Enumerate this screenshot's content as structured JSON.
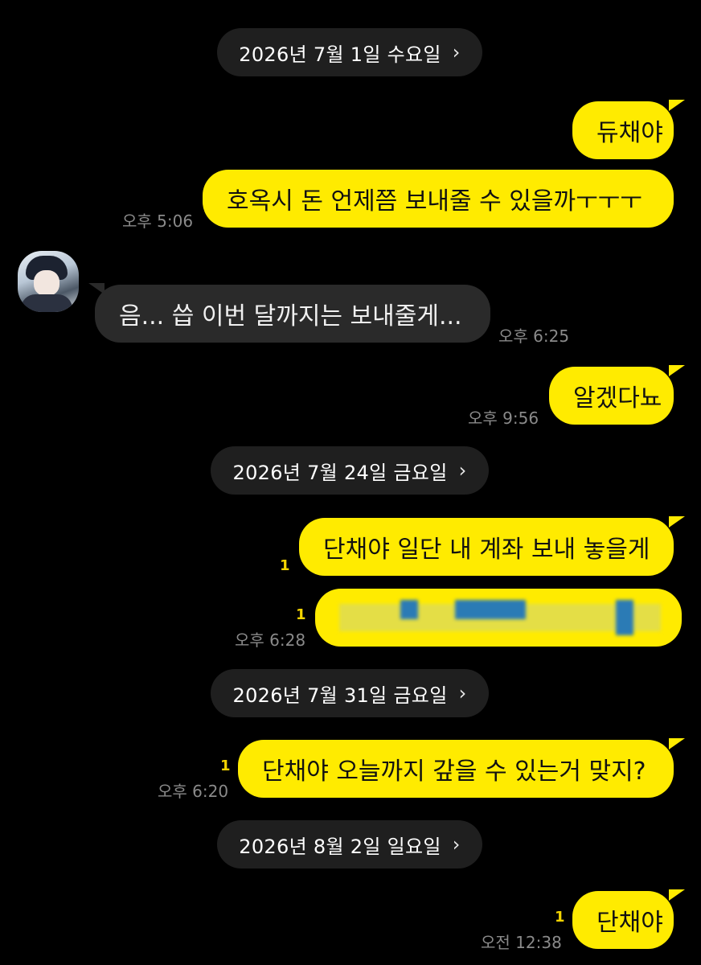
{
  "dates": [
    {
      "label": "2026년 7월 1일 수요일"
    },
    {
      "label": "2026년 7월 24일 금요일"
    },
    {
      "label": "2026년 7월 31일 금요일"
    },
    {
      "label": "2026년 8월 2일 일요일"
    }
  ],
  "chevron": "›",
  "messages": [
    {
      "text": "듀채야"
    },
    {
      "text": "호옥시 돈 언제쯤 보내줄 수 있을까ㅜㅜㅜ",
      "time": "오후 5:06"
    },
    {
      "text": "음... 씁 이번 달까지는 보내줄게...",
      "time": "오후 6:25"
    },
    {
      "text": "알겠다뇨",
      "time": "오후 9:56"
    },
    {
      "text": "단채야 일단 내 계좌 보내 놓을게",
      "unread": "1"
    },
    {
      "text": "",
      "unread": "1",
      "time": "오후 6:28"
    },
    {
      "text": "단채야 오늘까지 갚을 수 있는거 맞지?",
      "unread": "1",
      "time": "오후 6:20"
    },
    {
      "text": "단채야",
      "unread": "1",
      "time": "오전 12:38"
    }
  ],
  "colors": {
    "my_bubble": "#ffeb00",
    "other_bubble": "#2a2a2a",
    "background": "#000000",
    "unread": "#f4d400"
  }
}
